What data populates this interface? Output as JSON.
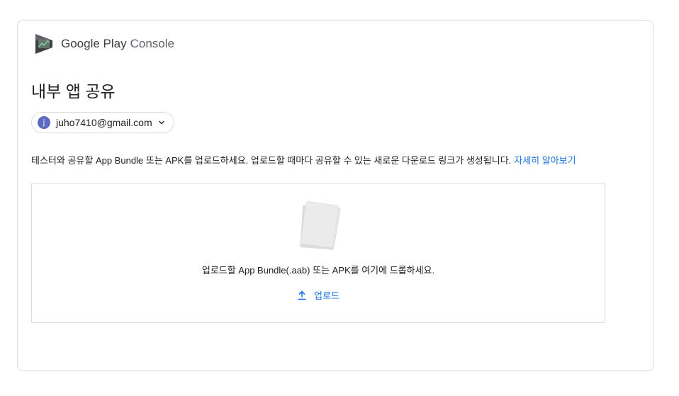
{
  "brand": {
    "name": "Google Play",
    "product": "Console",
    "icon": "google-play-console-icon",
    "colors": {
      "icon_dark": "#3c4043",
      "icon_accent": "#01875f"
    }
  },
  "page": {
    "title": "내부 앱 공유"
  },
  "account": {
    "avatar_letter": "j",
    "email": "juho7410@gmail.com",
    "avatar_color": "#5c6bc0"
  },
  "description": {
    "text": "테스터와 공유할 App Bundle 또는 APK를 업로드하세요. 업로드할 때마다 공유할 수 있는 새로운 다운로드 링크가 생성됩니다.",
    "link": "자세히 알아보기"
  },
  "dropzone": {
    "prompt": "업로드할 App Bundle(.aab) 또는 APK를 여기에 드롭하세요.",
    "upload_label": "업로드",
    "upload_icon": "upload-icon"
  },
  "colors": {
    "link": "#1a73e8",
    "border": "#dadce0"
  }
}
